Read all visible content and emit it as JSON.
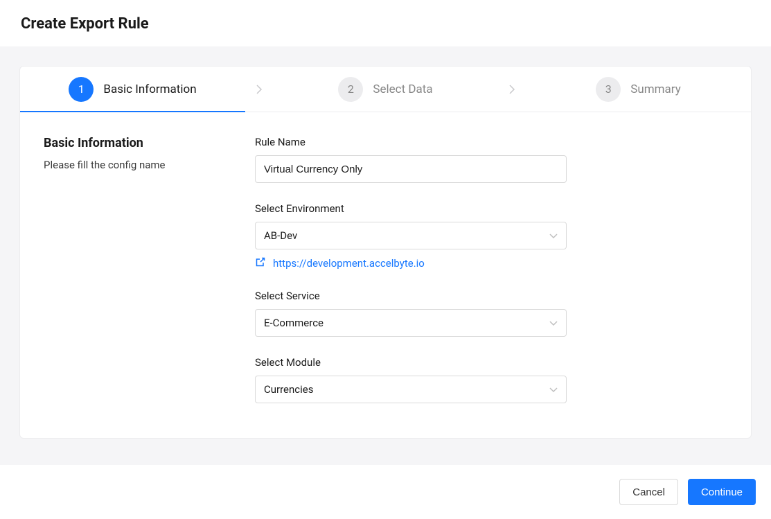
{
  "pageTitle": "Create Export Rule",
  "steps": [
    {
      "number": "1",
      "label": "Basic Information",
      "active": true
    },
    {
      "number": "2",
      "label": "Select Data",
      "active": false
    },
    {
      "number": "3",
      "label": "Summary",
      "active": false
    }
  ],
  "section": {
    "title": "Basic Information",
    "subtitle": "Please fill the config name"
  },
  "form": {
    "ruleName": {
      "label": "Rule Name",
      "value": "Virtual Currency Only"
    },
    "environment": {
      "label": "Select Environment",
      "value": "AB-Dev",
      "urlText": "https://development.accelbyte.io"
    },
    "service": {
      "label": "Select Service",
      "value": "E-Commerce"
    },
    "module": {
      "label": "Select Module",
      "value": "Currencies"
    }
  },
  "footer": {
    "cancel": "Cancel",
    "continue": "Continue"
  }
}
